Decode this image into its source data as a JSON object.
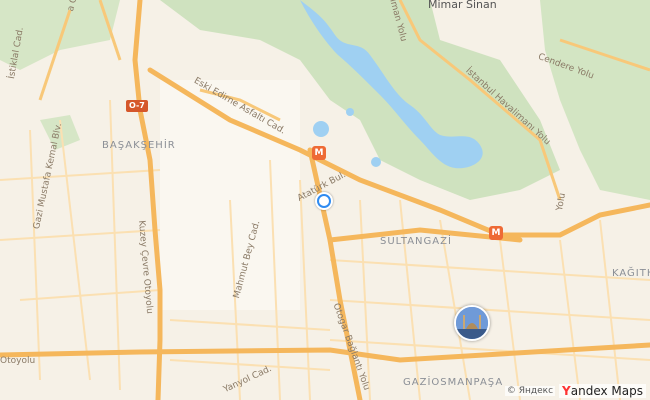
{
  "map": {
    "labels": {
      "mimar_sinan": "Mimar Sinan",
      "basaksehir": "BAŞAKŞEHİR",
      "sultangazi": "SULTANGAZİ",
      "gaziosmanpasa": "GAZİOSMANPAŞA",
      "kagithane": "KAĞITH",
      "istiklal_cad": "İstiklal Cad.",
      "eski_edirne": "Eski Edirne Asfaltı Cad.",
      "havalimani": "İstanbul Havalimanı Yolu",
      "cendere": "Cendere Yolu",
      "ataturk_bul": "Atatürk Bul.",
      "gazi_mustafa": "Gazi Mustafa Kemal Blv.",
      "kuzey_cevre": "Kuzey Çevre Otoyolu",
      "mahmut_bey": "Mahmut Bey Cad.",
      "otogar": "Otogar Bağlantı Yolu",
      "yanyol": "Yanyol Cad.",
      "otoyolu": "Otoyolu",
      "yolu_right": "Yolu",
      "mimar_sinan_road": "İman Yolu",
      "istiklal_top": "a Cad."
    },
    "shields": {
      "o7": "O-7"
    },
    "metro_glyph": "M",
    "attribution": {
      "yandex_small": "© Яндекс",
      "logo_y": "Y",
      "logo_rest": "andex Maps"
    },
    "icons": {
      "location": "current-location-icon",
      "poi": "mosque-icon",
      "metro": "metro-icon"
    },
    "colors": {
      "land": "#f6f1e7",
      "forest": "#cfe2bf",
      "water": "#9fd0f2",
      "major_road": "#f5b75c",
      "minor_road": "#fbe0b2",
      "location": "#2f8bf1"
    }
  }
}
